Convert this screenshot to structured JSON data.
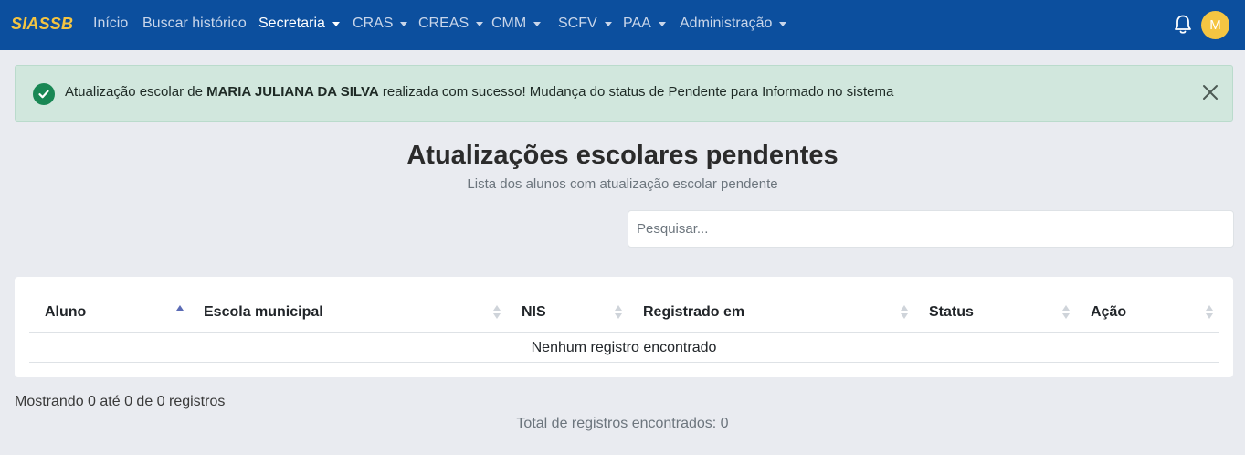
{
  "nav": {
    "brand": "SIASSB",
    "items": [
      {
        "label": "Início",
        "dropdown": false
      },
      {
        "label": "Buscar histórico",
        "dropdown": false
      },
      {
        "label": "Secretaria",
        "dropdown": true,
        "active": true
      },
      {
        "label": "CRAS",
        "dropdown": true
      },
      {
        "label": "CREAS",
        "dropdown": true
      },
      {
        "label": "CMM",
        "dropdown": true
      },
      {
        "label": "SCFV",
        "dropdown": true
      },
      {
        "label": "PAA",
        "dropdown": true
      },
      {
        "label": "Administração",
        "dropdown": true
      }
    ],
    "notification_icon": "bell-icon",
    "avatar_initial": "M"
  },
  "alert": {
    "prefix": "Atualização escolar de ",
    "name": "MARIA JULIANA DA SILVA",
    "suffix": " realizada com sucesso! Mudança do status de Pendente para Informado no sistema",
    "icon": "check-circle-icon",
    "close_icon": "close-icon"
  },
  "page": {
    "title": "Atualizações escolares pendentes",
    "subtitle": "Lista dos alunos com atualização escolar pendente"
  },
  "search": {
    "placeholder": "Pesquisar...",
    "value": ""
  },
  "table": {
    "columns": [
      {
        "label": "Aluno",
        "sort": "asc"
      },
      {
        "label": "Escola municipal",
        "sort": "none"
      },
      {
        "label": "NIS",
        "sort": "none"
      },
      {
        "label": "Registrado em",
        "sort": "none"
      },
      {
        "label": "Status",
        "sort": "none"
      },
      {
        "label": "Ação",
        "sort": "none"
      }
    ],
    "empty_message": "Nenhum registro encontrado"
  },
  "footer": {
    "info": "Mostrando 0 até 0 de 0 registros",
    "total": "Total de registros encontrados: 0"
  },
  "colors": {
    "navbar": "#0c4f9e",
    "brand": "#f5c542",
    "alert_bg": "#d1e7dd",
    "success": "#198754"
  }
}
